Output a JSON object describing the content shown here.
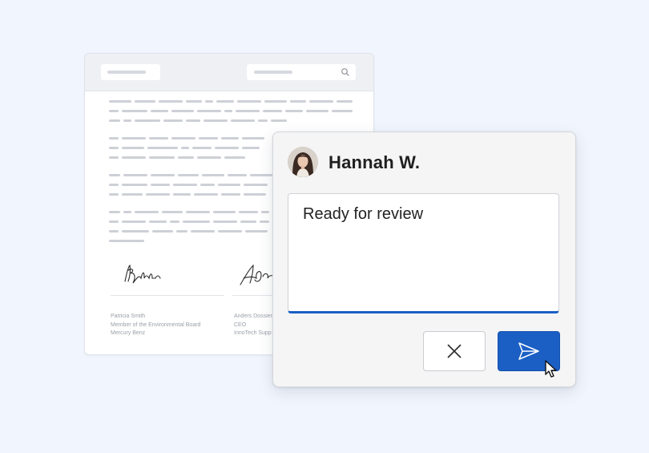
{
  "document": {
    "signatures": [
      {
        "name": "Patricia Smith",
        "role": "Member of the Environmental Board",
        "company": "Mercury Benz"
      },
      {
        "name": "Anders Dossier",
        "role": "CEO",
        "company": "InnoTech Supp"
      }
    ]
  },
  "dialog": {
    "user_name": "Hannah W.",
    "comment_text": "Ready for review"
  },
  "icons": {
    "search": "search-icon",
    "cancel": "close-icon",
    "send": "send-icon",
    "cursor": "mouse-pointer-icon"
  },
  "colors": {
    "background": "#f1f5fd",
    "accent": "#1b5fc4",
    "placeholder_line": "#cdd0d6"
  }
}
